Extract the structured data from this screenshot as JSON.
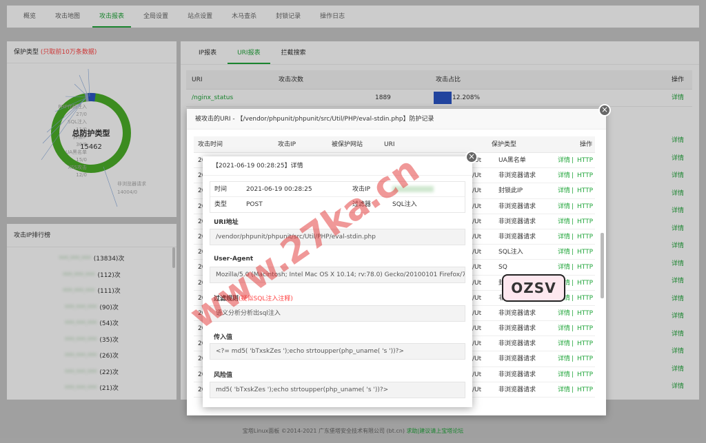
{
  "nav": {
    "tabs": [
      "概览",
      "攻击地图",
      "攻击报表",
      "全局设置",
      "站点设置",
      "木马查杀",
      "封锁记录",
      "操作日志"
    ],
    "active": 2
  },
  "protect": {
    "title": "保护类型",
    "note": "(只取前10万条数据)",
    "center_title": "总防护类型",
    "center_value": "15462",
    "labels": [
      "PHP代码注入",
      "SQL注入",
      "XSS攻击",
      "封锁IP",
      "UA黑名单",
      "UA黑名单2",
      "非浏览器请求",
      "非浏览器请求2"
    ],
    "values": [
      "27/0",
      "11/0",
      "11/0",
      "30/0",
      "15/0",
      "12/0",
      "13404/0"
    ],
    "bottom_label": "非浏览器请求",
    "bottom_value": "14004/0"
  },
  "ip_rank": {
    "title": "攻击IP排行榜",
    "rows": [
      {
        "ip": "***.***.***",
        "count": "(13834)次"
      },
      {
        "ip": "***.***.***",
        "count": "(112)次"
      },
      {
        "ip": "***.***.***",
        "count": "(111)次"
      },
      {
        "ip": "***.***.***",
        "count": "(90)次"
      },
      {
        "ip": "***.***.***",
        "count": "(54)次"
      },
      {
        "ip": "***.***.***",
        "count": "(35)次"
      },
      {
        "ip": "***.***.***",
        "count": "(26)次"
      },
      {
        "ip": "***.***.***",
        "count": "(22)次"
      },
      {
        "ip": "***.***.***",
        "count": "(21)次"
      }
    ]
  },
  "report": {
    "tabs": [
      "IP报表",
      "URI报表",
      "拦截搜索"
    ],
    "active": 1,
    "headers": {
      "uri": "URI",
      "count": "攻击次数",
      "percent": "攻击占比",
      "op": "操作"
    },
    "first_row": {
      "uri": "/nginx_status",
      "count": "1889",
      "percent": "12.208%"
    },
    "detail": "详情"
  },
  "dialog1": {
    "title": "被攻击的URI - 【/vendor/phpunit/phpunit/src/Util/PHP/eval-stdin.php】防护记录",
    "headers": [
      "攻击时间",
      "攻击IP",
      "被保护网站",
      "URI",
      "保护类型",
      "操作"
    ],
    "rows": [
      {
        "t": "20",
        "u": "/Ut",
        "type": "UA黑名单"
      },
      {
        "t": "20",
        "u": "/Ut",
        "type": "非浏览器请求"
      },
      {
        "t": "20",
        "u": "/Ut",
        "type": "封锁此IP"
      },
      {
        "t": "20",
        "u": "/Ut",
        "type": "非浏览器请求"
      },
      {
        "t": "20",
        "u": "/Ut",
        "type": "非浏览器请求"
      },
      {
        "t": "20",
        "u": "/Ut",
        "type": "非浏览器请求"
      },
      {
        "t": "20",
        "u": "/Ut",
        "type": "SQL注入"
      },
      {
        "t": "20",
        "u": "/Ut",
        "type": "SQ"
      },
      {
        "t": "20",
        "u": "/Ut",
        "type": "封"
      },
      {
        "t": "20",
        "u": "/Ut",
        "type": "非浏览器请求"
      },
      {
        "t": "20",
        "u": "/Ut",
        "type": "非浏览器请求"
      },
      {
        "t": "20",
        "u": "/Ut",
        "type": "非浏览器请求"
      },
      {
        "t": "20",
        "u": "/Ut",
        "type": "非浏览器请求"
      },
      {
        "t": "20",
        "u": "/Ut",
        "type": "非浏览器请求"
      },
      {
        "t": "20",
        "u": "/Ut",
        "type": "非浏览器请求"
      },
      {
        "t": "20",
        "u": "/Ut",
        "type": "非浏览器请求"
      }
    ],
    "op_detail": "详情",
    "op_sep": "|",
    "op_http": "HTTP"
  },
  "dialog2": {
    "title": "【2021-06-19 00:28:25】详情",
    "time_label": "时间",
    "time_value": "2021-06-19 00:28:25",
    "ip_label": "攻击IP",
    "ip_value": "",
    "type_label": "类型",
    "type_value": "POST",
    "filter_label": "过滤器",
    "filter_value": "SQL注入",
    "uri_label": "URI地址",
    "uri_value": "/vendor/phpunit/phpunit/src/Util/PHP/eval-stdin.php",
    "ua_label": "User-Agent",
    "ua_value": "Mozilla/5.0 (Macintosh; Intel Mac OS X 10.14; rv:78.0) Gecko/20100101 Firefox/78.0",
    "rule_label": "过滤规则",
    "rule_note": "(疑似SQL注入注释)",
    "rule_value": "语义分析分析出sql注入",
    "input_label": "传入值",
    "input_value": "<?= md5(   'bTxskZes   ');echo strtoupper(php_uname(   's   '))?>",
    "risk_label": "风险值",
    "risk_value": "md5(   'bTxskZes   ');echo strtoupper(php_uname(   's   '))?>"
  },
  "footer": {
    "text": "宝塔Linux面板 ©2014-2021 广东堡塔安全技术有限公司 (bt.cn)",
    "link": "求助|建议请上宝塔论坛"
  },
  "watermark": {
    "text": "www.27ka.cn",
    "logo": "OZSV"
  },
  "colors": {
    "accent": "#20a53a",
    "bar": "#2b55c6",
    "ring": "#4caf28"
  }
}
